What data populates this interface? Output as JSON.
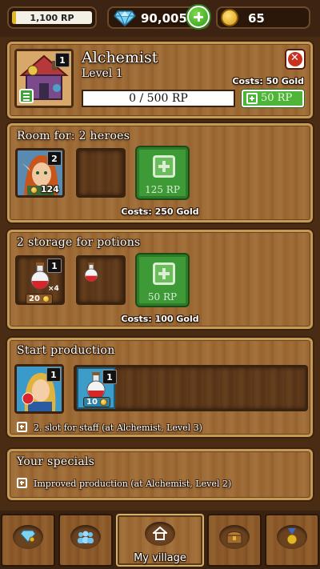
{
  "topbar": {
    "rp_label": "1,100 RP",
    "rp_fill": 0.05,
    "gems": "90,005",
    "gold": "65",
    "icons": {
      "gem": "diamond-icon",
      "add": "plus-icon",
      "coin": "gold-coin-icon"
    }
  },
  "building": {
    "name": "Alchemist",
    "level": "Level 1",
    "count_badge": "1",
    "costs": "Costs: 50 Gold",
    "progress_text": "0 / 500 RP",
    "progress_fraction": 0,
    "buy_label": "50 RP"
  },
  "rooms": {
    "title": "Room for: 2 heroes",
    "hero": {
      "badge": "2",
      "value": "124"
    },
    "unlock_label": "125 RP",
    "costs": "Costs: 250 Gold"
  },
  "storage": {
    "title": "2 storage for potions",
    "slot1": {
      "badge": "1",
      "multiplier": "×4",
      "price": "20"
    },
    "unlock_label": "50 RP",
    "costs": "Costs: 100 Gold"
  },
  "production": {
    "title": "Start production",
    "staff_badge": "1",
    "potion_badge": "1",
    "potion_price": "10",
    "note": "2. slot for staff (at Alchemist, Level 3)"
  },
  "specials": {
    "title": "Your specials",
    "note": "Improved production (at Alchemist, Level 2)"
  },
  "nav": {
    "home_label": "My village",
    "icons": [
      "gem-shop-icon",
      "heroes-icon",
      "home-icon",
      "treasure-chest-icon",
      "medal-icon"
    ]
  },
  "colors": {
    "green": "#3d9a37",
    "wood": "#8a5a2b",
    "frame": "#c59a55"
  }
}
